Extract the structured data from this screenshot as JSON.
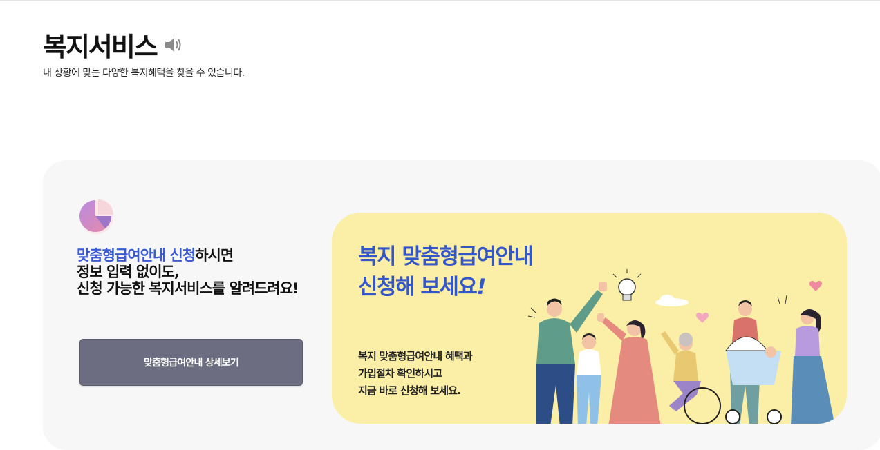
{
  "page": {
    "title": "복지서비스",
    "subtitle": "내 상황에 맞는 다양한 복지혜택을 찾을 수 있습니다."
  },
  "intro": {
    "highlight": "맞춤형급여안내 신청",
    "line1_rest": "하시면",
    "line2": "정보 입력 없이도,",
    "line3": "신청 가능한 복지서비스를 알려드려요!"
  },
  "detail_button_label": "맞춤형급여안내 상세보기",
  "banner": {
    "heading_line1": "복지 맞춤형급여안내",
    "heading_line2_text": "신청해 보세요",
    "heading_line2_excl": "!",
    "body_line1": "복지 맞춤형급여안내 혜택과",
    "body_line2": "가입절차 확인하시고",
    "body_line3": "지금 바로 신청해 보세요."
  },
  "icons": {
    "speaker": "speaker-icon",
    "pie": "pie-chart-icon"
  },
  "colors": {
    "accent_blue": "#3a5bd3",
    "button_bg": "#6c6d80",
    "banner_bg": "#fbeea6",
    "panel_bg": "#f7f7f7"
  }
}
